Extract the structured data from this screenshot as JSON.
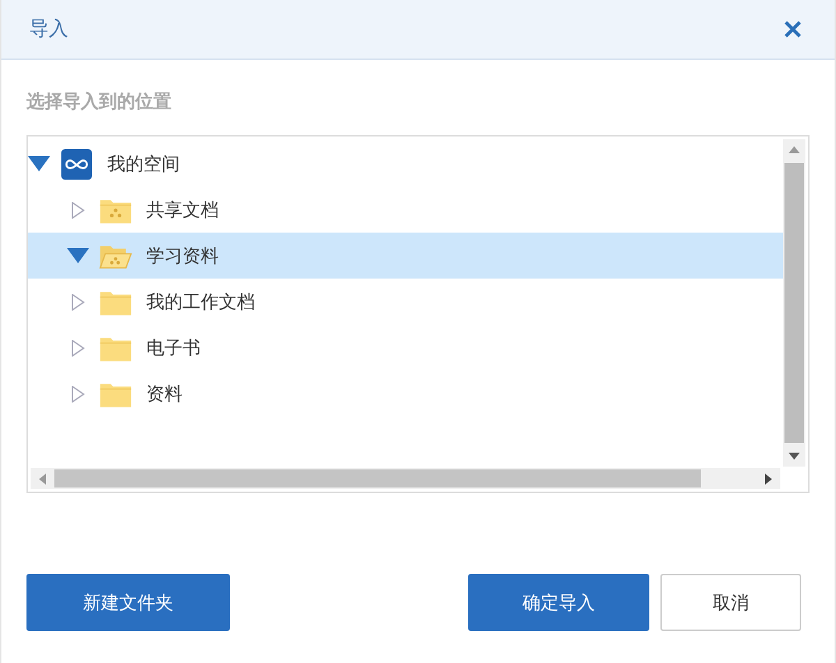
{
  "window": {
    "title": "导入"
  },
  "prompt": "选择导入到的位置",
  "tree": [
    {
      "label": "我的空间",
      "kind": "cloud",
      "expanded": true,
      "selected": false,
      "children": [
        {
          "label": "共享文档",
          "kind": "shared",
          "expanded": false,
          "selected": false
        },
        {
          "label": "学习资料",
          "kind": "shared",
          "expanded": true,
          "selected": true
        },
        {
          "label": "我的工作文档",
          "kind": "folder",
          "expanded": false,
          "selected": false
        },
        {
          "label": "电子书",
          "kind": "folder",
          "expanded": false,
          "selected": false
        },
        {
          "label": "资料",
          "kind": "folder",
          "expanded": false,
          "selected": false
        }
      ]
    }
  ],
  "buttons": [
    {
      "label": "新建文件夹",
      "kind": "primary"
    },
    {
      "label": "确定导入",
      "kind": "primary"
    },
    {
      "label": "取消",
      "kind": "secondary"
    }
  ]
}
